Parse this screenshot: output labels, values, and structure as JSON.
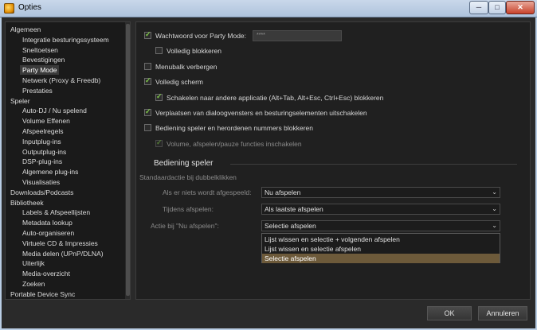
{
  "window": {
    "title": "Opties",
    "minimize": "─",
    "maximize": "□",
    "close": "✕"
  },
  "sidebar": {
    "items": [
      {
        "label": "Algemeen",
        "level": 0
      },
      {
        "label": "Integratie besturingssysteem",
        "level": 1
      },
      {
        "label": "Sneltoetsen",
        "level": 1
      },
      {
        "label": "Bevestigingen",
        "level": 1
      },
      {
        "label": "Party Mode",
        "level": 1,
        "selected": true
      },
      {
        "label": "Netwerk (Proxy & Freedb)",
        "level": 1
      },
      {
        "label": "Prestaties",
        "level": 1
      },
      {
        "label": "Speler",
        "level": 0
      },
      {
        "label": "Auto-DJ / Nu spelend",
        "level": 1
      },
      {
        "label": "Volume Effenen",
        "level": 1
      },
      {
        "label": "Afspeelregels",
        "level": 1
      },
      {
        "label": "Inputplug-ins",
        "level": 1
      },
      {
        "label": "Outputplug-ins",
        "level": 1
      },
      {
        "label": "DSP-plug-ins",
        "level": 1
      },
      {
        "label": "Algemene plug-ins",
        "level": 1
      },
      {
        "label": "Visualisaties",
        "level": 1
      },
      {
        "label": "Downloads/Podcasts",
        "level": 0
      },
      {
        "label": "Bibliotheek",
        "level": 0
      },
      {
        "label": "Labels & Afspeellijsten",
        "level": 1
      },
      {
        "label": "Metadata lookup",
        "level": 1
      },
      {
        "label": "Auto-organiseren",
        "level": 1
      },
      {
        "label": "Virtuele CD & Impressies",
        "level": 1
      },
      {
        "label": "Media delen (UPnP/DLNA)",
        "level": 1
      },
      {
        "label": "Uiterlijk",
        "level": 1
      },
      {
        "label": "Media-overzicht",
        "level": 1
      },
      {
        "label": "Zoeken",
        "level": 1
      },
      {
        "label": "Portable Device Sync",
        "level": 0
      }
    ]
  },
  "party_mode": {
    "password_label": "Wachtwoord voor Party Mode:",
    "password_value": "****",
    "full_lock": "Volledig blokkeren",
    "hide_menubar": "Menubalk verbergen",
    "fullscreen": "Volledig scherm",
    "block_switch": "Schakelen naar andere applicatie (Alt+Tab, Alt+Esc, Ctrl+Esc) blokkeren",
    "disable_move": "Verplaatsen van dialoogvensters en besturingselementen uitschakelen",
    "block_reorder": "Bediening speler en herordenen nummers blokkeren",
    "volume_functions": "Volume, afspelen/pauze functies inschakelen"
  },
  "player_control": {
    "section_title": "Bediening speler",
    "default_action": "Standaardactie bij dubbelklikken",
    "when_idle_label": "Als er niets wordt afgespeeld:",
    "when_idle_value": "Nu afspelen",
    "when_playing_label": "Tijdens afspelen:",
    "when_playing_value": "Als laatste afspelen",
    "play_now_label": "Actie bij \"Nu afspelen\":",
    "play_now_value": "Selectie afspelen",
    "play_now_options": [
      "Lijst wissen en selectie + volgenden afspelen",
      "Lijst wissen en selectie afspelen",
      "Selectie afspelen"
    ],
    "highlighted_option": 2
  },
  "footer": {
    "ok": "OK",
    "cancel": "Annuleren"
  },
  "colors": {
    "background": "#2a2a2a",
    "highlight": "#6d5a3a",
    "check": "#7fc74a"
  },
  "icons": {
    "app": "app-logo-icon",
    "checkbox": "checkmark-icon",
    "dropdown": "chevron-down-icon"
  }
}
